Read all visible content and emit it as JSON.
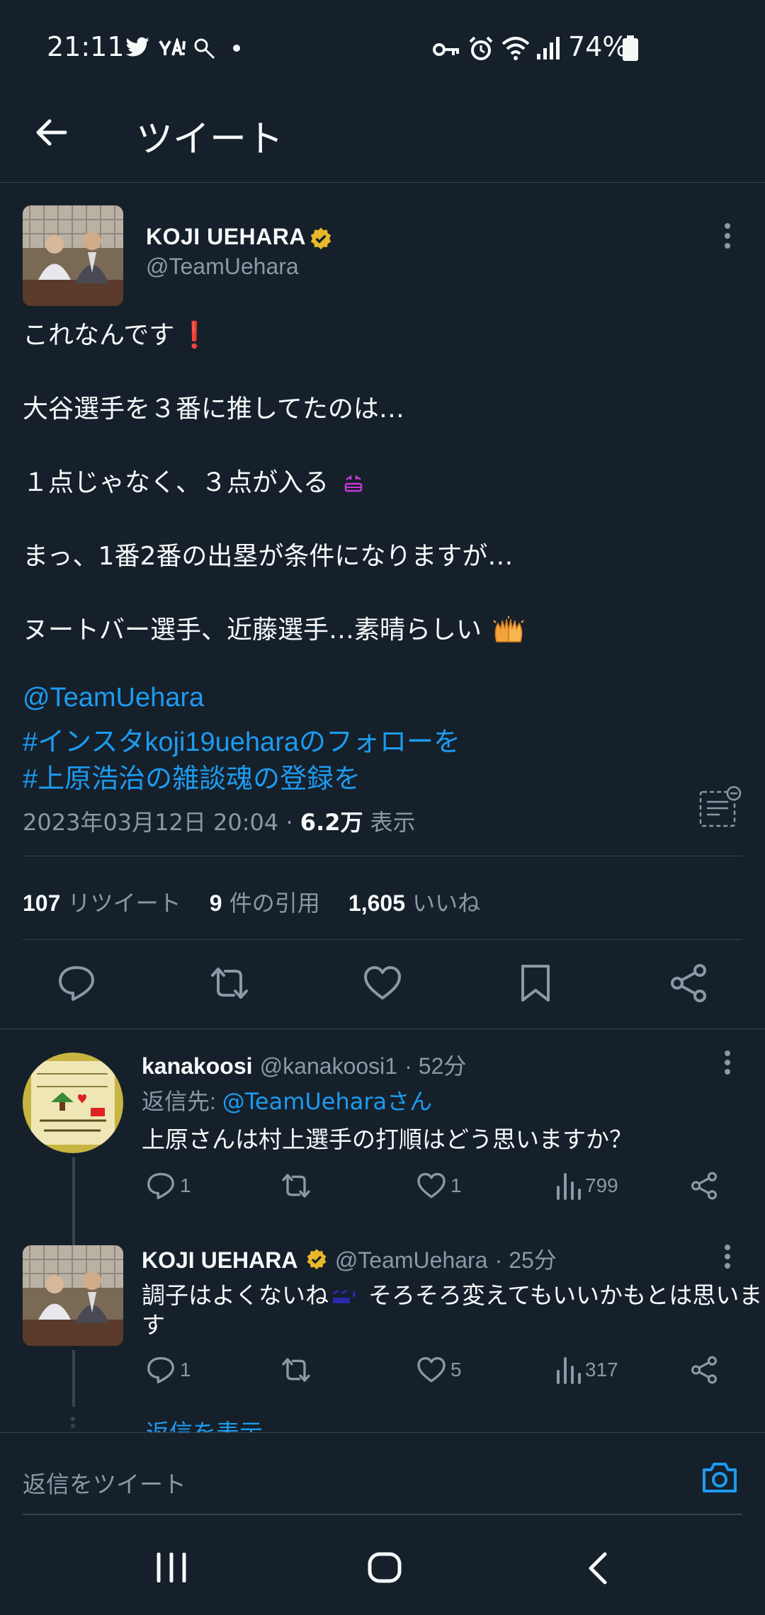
{
  "status_bar": {
    "time": "21:11",
    "battery": "74%"
  },
  "header": {
    "title": "ツイート"
  },
  "tweet": {
    "author_name": "KOJI UEHARA",
    "author_handle": "@TeamUehara",
    "lines": [
      "これなんです",
      "大谷選手を３番に推してたのは…",
      "１点じゃなく、３点が入る",
      "まっ、1番2番の出塁が条件になりますが…",
      "ヌートバー選手、近藤選手…素晴らしい"
    ],
    "links": [
      "@TeamUehara",
      "#インスタkoji19ueharaのフォローを",
      "#上原浩治の雑談魂の登録を"
    ],
    "timestamp": "2023年03月12日 20:04",
    "separator": " · ",
    "views_count": "6.2万",
    "views_label": "表示"
  },
  "stats": {
    "retweets_count": "107",
    "retweets_label": "リツイート",
    "quotes_count": "9",
    "quotes_label": "件の引用",
    "likes_count": "1,605",
    "likes_label": "いいね"
  },
  "replies": [
    {
      "name": "kanakoosi",
      "handle": "@kanakoosi1",
      "time": "· 52分",
      "reply_to_label": "返信先: ",
      "reply_to_target": "@TeamUeharaさん",
      "text": "上原さんは村上選手の打順はどう思いますか？",
      "replies": "1",
      "likes": "1",
      "views": "799"
    },
    {
      "name": "KOJI UEHARA",
      "handle": "@TeamUehara",
      "time": "· 25分",
      "text_line1": "調子はよくないね",
      "text_line1b": "そろそろ変えてもいいかもとは思いま",
      "text_line2": "す",
      "replies": "1",
      "likes": "5",
      "views": "317"
    }
  ],
  "show_replies_link": "返信を表示",
  "composer": {
    "placeholder": "返信をツイート"
  },
  "colors": {
    "background": "#15202b",
    "accent": "#1d9bf0",
    "muted": "#8b98a5",
    "divider": "#38444d",
    "verified": "#e8b82a"
  },
  "icons": [
    "back-arrow-icon",
    "more-icon",
    "reply-icon",
    "retweet-icon",
    "like-icon",
    "bookmark-icon",
    "share-icon",
    "views-icon",
    "camera-icon",
    "translate-icon",
    "verified-badge-icon"
  ]
}
